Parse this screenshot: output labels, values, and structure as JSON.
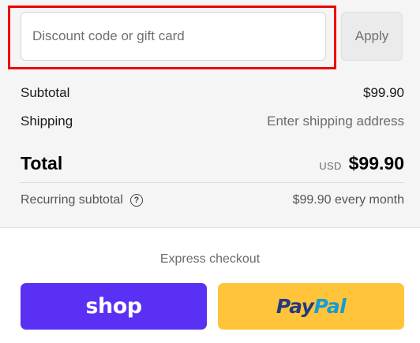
{
  "discount": {
    "placeholder": "Discount code or gift card",
    "value": "",
    "apply_label": "Apply"
  },
  "summary": {
    "subtotal_label": "Subtotal",
    "subtotal_value": "$99.90",
    "shipping_label": "Shipping",
    "shipping_value": "Enter shipping address",
    "total_label": "Total",
    "currency": "USD",
    "total_value": "$99.90",
    "recurring_label": "Recurring subtotal",
    "recurring_icon": "question-circle-icon",
    "recurring_value": "$99.90 every month"
  },
  "express": {
    "label": "Express checkout",
    "shop_label": "shop",
    "paypal_part1": "Pay",
    "paypal_part2": "Pal"
  },
  "colors": {
    "highlight": "#ee0000",
    "shop": "#5a31f4",
    "paypal": "#ffc439",
    "paypal_dark": "#253b80",
    "paypal_light": "#179bd7"
  }
}
